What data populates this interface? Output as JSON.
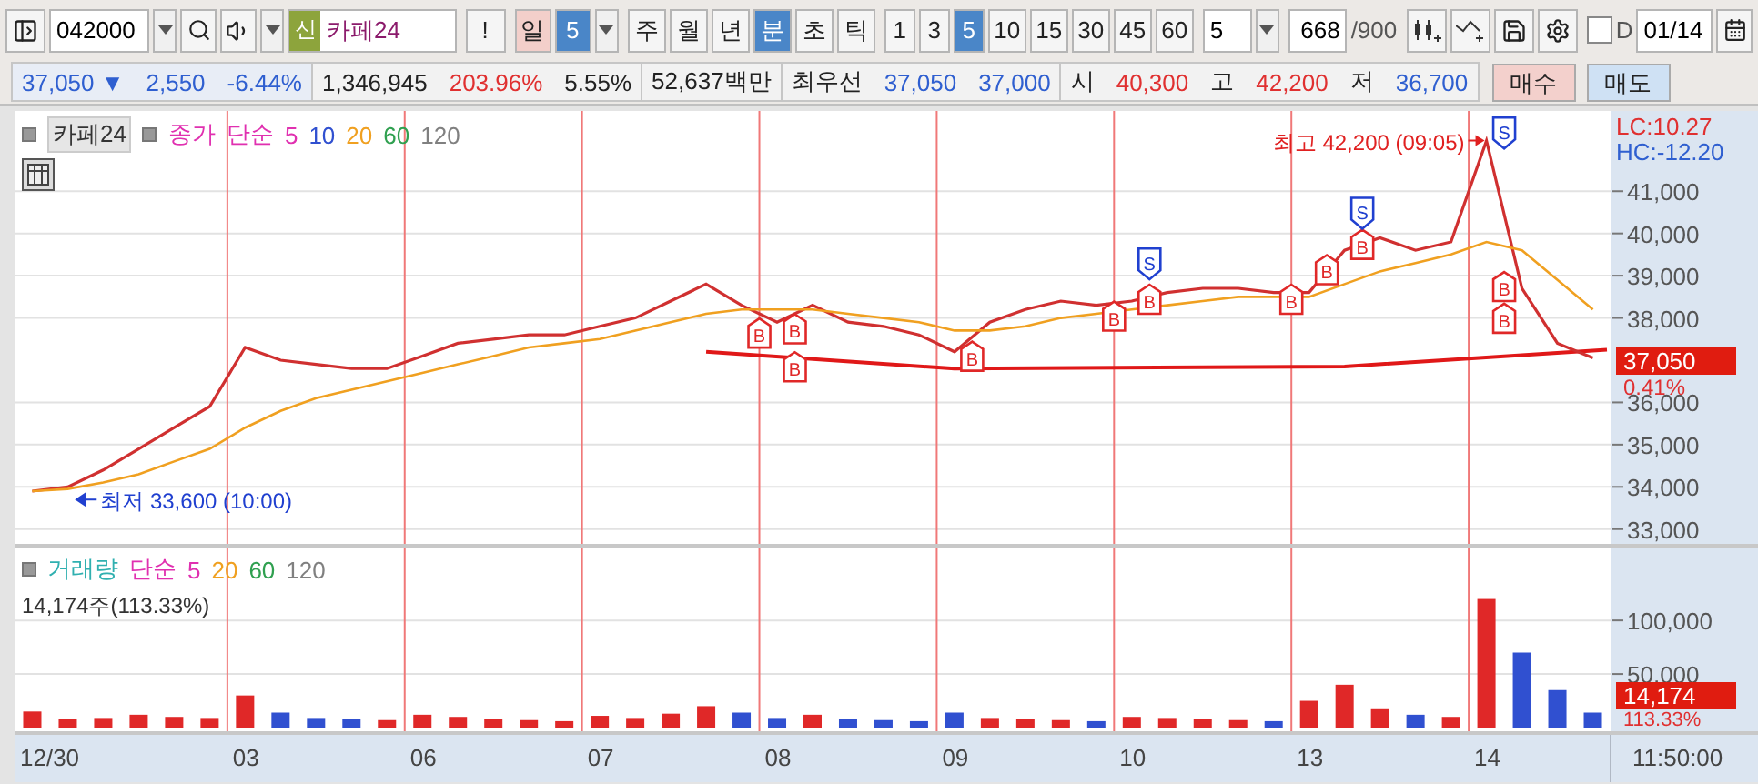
{
  "toolbar": {
    "code_field": {
      "value": "042000"
    },
    "stock_badge": "신",
    "stock_name": "카페24",
    "alert_button": "!",
    "day_button": {
      "label": "일",
      "highlighted": true
    },
    "day_count": "5",
    "periods": [
      {
        "label": "주",
        "selected": false
      },
      {
        "label": "월",
        "selected": false
      },
      {
        "label": "년",
        "selected": false
      },
      {
        "label": "분",
        "selected": true
      },
      {
        "label": "초",
        "selected": false
      },
      {
        "label": "틱",
        "selected": false
      }
    ],
    "intervals": [
      {
        "label": "1",
        "selected": false
      },
      {
        "label": "3",
        "selected": false
      },
      {
        "label": "5",
        "selected": true
      },
      {
        "label": "10",
        "selected": false
      },
      {
        "label": "15",
        "selected": false
      },
      {
        "label": "30",
        "selected": false
      },
      {
        "label": "45",
        "selected": false
      },
      {
        "label": "60",
        "selected": false
      }
    ],
    "interval_select": "5",
    "count_field": {
      "value": "668"
    },
    "count_total": "/900",
    "date_checkbox": {
      "label": "D",
      "checked": false
    },
    "date_field": {
      "value": "01/14"
    }
  },
  "quote_bar": {
    "groups": [
      [
        {
          "text": "37,050 ▼",
          "color": "#2f5fd0"
        },
        {
          "text": "2,550",
          "color": "#2f5fd0"
        },
        {
          "text": "-6.44%",
          "color": "#2f5fd0"
        }
      ],
      [
        {
          "text": "1,346,945",
          "color": "#222222"
        },
        {
          "text": "203.96%",
          "color": "#e03030"
        },
        {
          "text": "5.55%",
          "color": "#222222"
        }
      ],
      [
        {
          "text": "52,637백만",
          "color": "#222222"
        }
      ],
      [
        {
          "text": "최우선",
          "color": "#222222"
        },
        {
          "text": "37,050",
          "color": "#2f5fd0"
        },
        {
          "text": "37,000",
          "color": "#2f5fd0"
        }
      ],
      [
        {
          "text": "시",
          "color": "#222222"
        },
        {
          "text": "40,300",
          "color": "#e03030"
        },
        {
          "text": "고",
          "color": "#222222"
        },
        {
          "text": "42,200",
          "color": "#e03030"
        },
        {
          "text": "저",
          "color": "#222222"
        },
        {
          "text": "36,700",
          "color": "#2f5fd0"
        }
      ]
    ],
    "buy_button": "매수",
    "sell_button": "매도"
  },
  "price_pane": {
    "title_button": "카페24",
    "legend": [
      {
        "text": "종가",
        "color": "#e030b0"
      },
      {
        "text": "단순",
        "color": "#e030b0"
      },
      {
        "text": "5",
        "color": "#e030b0"
      },
      {
        "text": "10",
        "color": "#3050d0"
      },
      {
        "text": "20",
        "color": "#f0a020"
      },
      {
        "text": "60",
        "color": "#30a050"
      },
      {
        "text": "120",
        "color": "#808080"
      }
    ],
    "axis_labels": {
      "lc": "LC:10.27",
      "hc": "HC:-12.20",
      "current_price": "37,050",
      "change": "0.41%"
    },
    "chart_data": {
      "type": "line",
      "ylim": [
        32650,
        42900
      ],
      "grid": true,
      "yticks": [
        {
          "value": 33000,
          "label": "33,000"
        },
        {
          "value": 34000,
          "label": "34,000"
        },
        {
          "value": 35000,
          "label": "35,000"
        },
        {
          "value": 36000,
          "label": "36,000"
        },
        {
          "value": 38000,
          "label": "38,000"
        },
        {
          "value": 39000,
          "label": "39,000"
        },
        {
          "value": 40000,
          "label": "40,000"
        },
        {
          "value": 41000,
          "label": "41,000"
        }
      ],
      "series": [
        {
          "color": "#d03030",
          "values": [
            33900,
            34000,
            34400,
            34900,
            35400,
            35900,
            37300,
            37000,
            36900,
            36800,
            36800,
            37100,
            37400,
            37500,
            37600,
            37600,
            37800,
            38000,
            38400,
            38800,
            38300,
            37900,
            38300,
            37900,
            37800,
            37600,
            37200,
            37900,
            38200,
            38400,
            38300,
            38400,
            38600,
            38700,
            38700,
            38600,
            38600,
            39600,
            39900,
            39600,
            39800,
            42200,
            38700,
            37400,
            37050
          ]
        },
        {
          "color": "#f0a020",
          "values": [
            33900,
            33950,
            34100,
            34300,
            34600,
            34900,
            35400,
            35800,
            36100,
            36300,
            36500,
            36700,
            36900,
            37100,
            37300,
            37400,
            37500,
            37700,
            37900,
            38100,
            38200,
            38200,
            38200,
            38100,
            38000,
            37900,
            37700,
            37700,
            37800,
            38000,
            38100,
            38200,
            38300,
            38400,
            38500,
            38500,
            38500,
            38800,
            39100,
            39300,
            39500,
            39800,
            39600,
            38900,
            38200
          ]
        }
      ]
    },
    "markers": [
      {
        "kind": "high",
        "text": "최고 42,200 (09:05)"
      },
      {
        "kind": "low",
        "text": "최저 33,600 (10:00)"
      },
      {
        "kind": "buy",
        "text": "B"
      },
      {
        "kind": "buy",
        "text": "B"
      },
      {
        "kind": "buy",
        "text": "B"
      },
      {
        "kind": "buy",
        "text": "B"
      },
      {
        "kind": "buy",
        "text": "B"
      },
      {
        "kind": "buy",
        "text": "B"
      },
      {
        "kind": "buy",
        "text": "B"
      },
      {
        "kind": "buy",
        "text": "B"
      },
      {
        "kind": "buy",
        "text": "B"
      },
      {
        "kind": "buy",
        "text": "B"
      },
      {
        "kind": "buy",
        "text": "B"
      },
      {
        "kind": "sell",
        "text": "S"
      },
      {
        "kind": "sell",
        "text": "S"
      },
      {
        "kind": "sell",
        "text": "S"
      }
    ]
  },
  "volume_pane": {
    "legend": [
      {
        "text": "거래량",
        "color": "#30b0b0"
      },
      {
        "text": "단순",
        "color": "#e030b0"
      },
      {
        "text": "5",
        "color": "#e030b0"
      },
      {
        "text": "20",
        "color": "#f0a020"
      },
      {
        "text": "60",
        "color": "#30a050"
      },
      {
        "text": "120",
        "color": "#808080"
      }
    ],
    "summary": "14,174주(113.33%)",
    "axis_labels": {
      "current_volume": "14,174",
      "ratio": "113.33%"
    },
    "chart_data": {
      "type": "bar",
      "ylim": [
        0,
        168000
      ],
      "yticks": [
        {
          "value": 50000,
          "label": "50,000"
        },
        {
          "value": 100000,
          "label": "100,000"
        }
      ],
      "values": [
        15000,
        8000,
        9000,
        12000,
        10000,
        9000,
        30000,
        14000,
        9000,
        8000,
        7000,
        12000,
        10000,
        8000,
        7000,
        6000,
        11000,
        9000,
        13000,
        20000,
        14000,
        9000,
        12000,
        8000,
        7000,
        6000,
        14000,
        9000,
        8000,
        7000,
        6000,
        10000,
        9000,
        8000,
        7000,
        6000,
        25000,
        40000,
        18000,
        12000,
        10000,
        120000,
        70000,
        35000,
        14000
      ]
    }
  },
  "time_axis": {
    "days": [
      {
        "label": "12/30"
      },
      {
        "label": "03"
      },
      {
        "label": "06"
      },
      {
        "label": "07"
      },
      {
        "label": "08"
      },
      {
        "label": "09"
      },
      {
        "label": "10"
      },
      {
        "label": "13"
      },
      {
        "label": "14"
      }
    ],
    "clock": "11:50:00"
  }
}
